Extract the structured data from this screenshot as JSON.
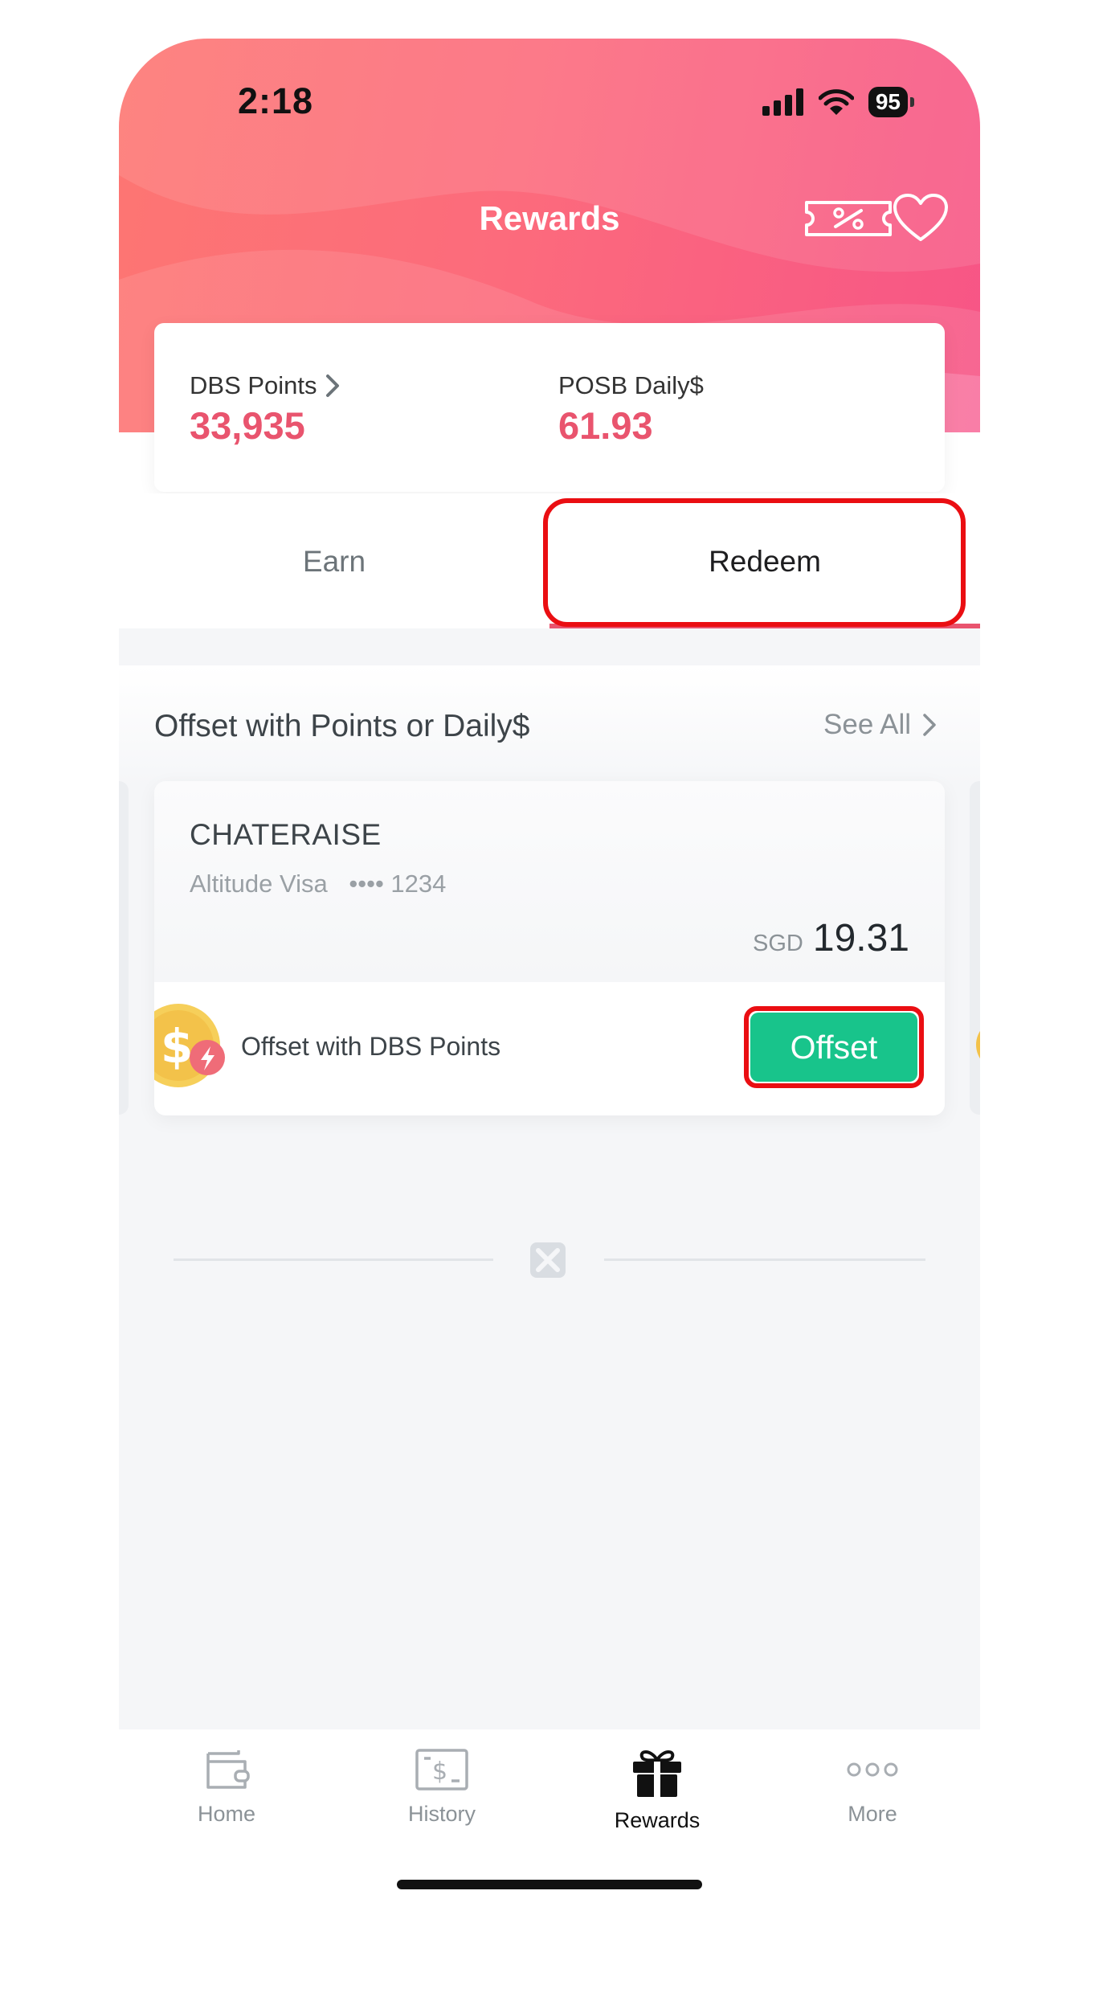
{
  "status_bar": {
    "time": "2:18",
    "battery": "95"
  },
  "header": {
    "title": "Rewards"
  },
  "points": {
    "dbs_label": "DBS Points",
    "dbs_value": "33,935",
    "posb_label": "POSB Daily$",
    "posb_value": "61.93"
  },
  "tabs": {
    "earn": "Earn",
    "redeem": "Redeem",
    "active": "redeem"
  },
  "section": {
    "title": "Offset with Points or Daily$",
    "see_all": "See All"
  },
  "transaction": {
    "merchant": "CHATERAISE",
    "card": "Altitude Visa",
    "card_mask": "•••• 1234",
    "currency": "SGD",
    "amount": "19.31",
    "offset_text": "Offset with DBS Points",
    "offset_button": "Offset"
  },
  "nav": [
    {
      "label": "Home",
      "icon": "wallet-icon"
    },
    {
      "label": "History",
      "icon": "dollar-bill-icon"
    },
    {
      "label": "Rewards",
      "icon": "gift-icon"
    },
    {
      "label": "More",
      "icon": "more-dots-icon"
    }
  ],
  "colors": {
    "header_gradient_start": "#fd7672",
    "header_gradient_end": "#f75586",
    "accent": "#e9546e",
    "offset_button": "#18c48b",
    "highlight": "#ea0e12"
  }
}
